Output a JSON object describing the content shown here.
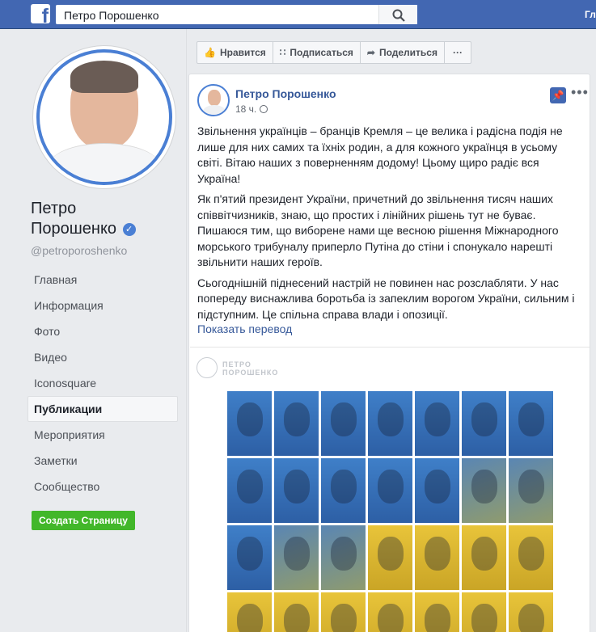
{
  "topbar": {
    "logo_letter": "f",
    "search_value": "Петро Порошенко",
    "right_label": "Гл"
  },
  "profile": {
    "name_line1": "Петро",
    "name_line2": "Порошенко",
    "verified_glyph": "✓",
    "handle": "@petroporoshenko"
  },
  "nav": {
    "items": [
      {
        "label": "Главная"
      },
      {
        "label": "Информация"
      },
      {
        "label": "Фото"
      },
      {
        "label": "Видео"
      },
      {
        "label": "Iconosquare"
      },
      {
        "label": "Публикации"
      },
      {
        "label": "Мероприятия"
      },
      {
        "label": "Заметки"
      },
      {
        "label": "Сообщество"
      }
    ],
    "active_index": 5,
    "create_page_label": "Создать Страницу"
  },
  "action_bar": {
    "like_label": "Нравится",
    "follow_label": "Подписаться",
    "share_label": "Поделиться",
    "more_label": "···"
  },
  "post": {
    "author": "Петро Порошенко",
    "time": "18 ч.",
    "paragraphs": [
      "Звільнення українців – бранців Кремля – це велика і радісна подія не лише для них самих та їхніх родин, а для кожного українця в усьому світі. Вітаю наших з поверненням додому! Цьому щиро радіє вся Україна!",
      "Як п'ятий президент України, причетний до звільнення тисяч наших співвітчизників, знаю, що простих і лінійних рішень тут не буває. Пишаюся тим, що виборене нами ще весною рішення Міжнародного морського трибуналу приперло Путіна до стіни і спонукало нарешті звільнити наших героїв.",
      "Сьогоднішній піднесений настрій не повинен нас розслабляти. У нас попереду виснажлива боротьба із запеклим ворогом України, сильним і підступним. Це спільна справа влади і опозиції."
    ],
    "translate_link": "Показать перевод",
    "image_logo_line1": "ПЕТРО",
    "image_logo_line2": "ПОРОШЕНКО"
  },
  "colors": {
    "brand_blue": "#4267b2",
    "link": "#365899",
    "create_green": "#42b72a",
    "flag_blue": "#3f7fc8",
    "flag_yellow": "#e8c43a"
  }
}
